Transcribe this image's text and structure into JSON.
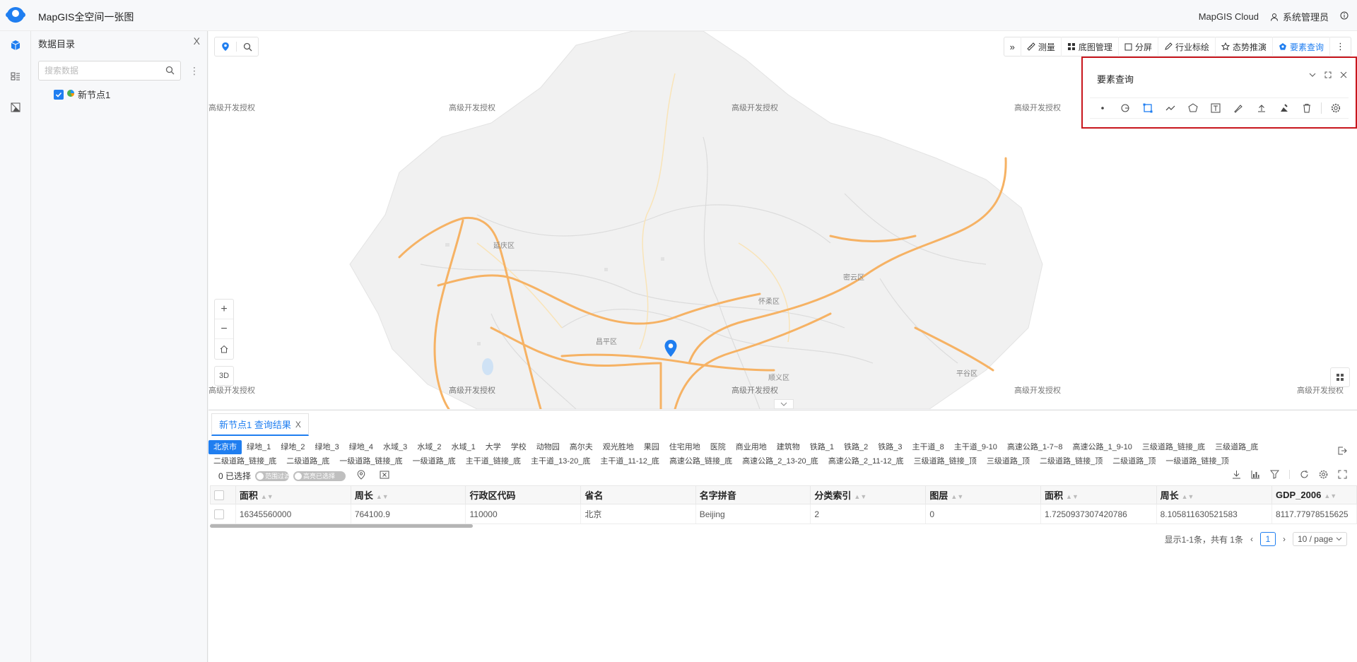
{
  "header": {
    "title": "MapGIS全空间一张图",
    "cloud_label": "MapGIS Cloud",
    "user_name": "系统管理员"
  },
  "catalog": {
    "title": "数据目录",
    "close_label": "X",
    "search_placeholder": "搜索数据",
    "tree_node_label": "新节点1"
  },
  "map": {
    "watermark": "高级开发授权",
    "place_names": [
      "延庆区",
      "怀柔区",
      "密云区",
      "昌平区",
      "顺义区",
      "平谷区"
    ],
    "btn_3d": "3D"
  },
  "toolbar": {
    "items": [
      "测量",
      "底图管理",
      "分屏",
      "行业标绘",
      "态势推演",
      "要素查询"
    ]
  },
  "query_panel": {
    "title": "要素查询"
  },
  "result": {
    "tab_label": "新节点1 查询结果",
    "tab_close": "X",
    "layer_tabs": [
      "北京市",
      "绿地_1",
      "绿地_2",
      "绿地_3",
      "绿地_4",
      "水域_3",
      "水域_2",
      "水域_1",
      "大学",
      "学校",
      "动物园",
      "高尔夫",
      "观光胜地",
      "果园",
      "住宅用地",
      "医院",
      "商业用地",
      "建筑物",
      "铁路_1",
      "铁路_2",
      "铁路_3",
      "主干道_8",
      "主干道_9-10",
      "高速公路_1-7~8",
      "高速公路_1_9-10",
      "三级道路_链接_底",
      "三级道路_底",
      "二级道路_链接_底",
      "二级道路_底",
      "一级道路_链接_底",
      "一级道路_底",
      "主干道_链接_底",
      "主干道_13-20_底",
      "主干道_11-12_底",
      "高速公路_链接_底",
      "高速公路_2_13-20_底",
      "高速公路_2_11-12_底",
      "三级道路_链接_顶",
      "三级道路_顶",
      "二级道路_链接_顶",
      "二级道路_顶",
      "一级道路_链接_顶"
    ],
    "selected_label": "0 已选择",
    "switch_filter": "范围过滤",
    "switch_highlight": "高亮已选择",
    "columns": [
      "面积",
      "周长",
      "行政区代码",
      "省名",
      "名字拼音",
      "分类索引",
      "图层",
      "面积",
      "周长",
      "GDP_2006"
    ],
    "rows": [
      [
        "16345560000",
        "764100.9",
        "110000",
        "北京",
        "Beijing",
        "2",
        "0",
        "1.7250937307420786",
        "8.105811630521583",
        "8117.77978515625"
      ]
    ],
    "pager": {
      "summary": "显示1-1条，共有 1条",
      "page": "1",
      "size": "10 / page"
    }
  },
  "colors": {
    "accent": "#1f7ef0",
    "highlight_border": "#c8161d",
    "road": "#f6b264"
  }
}
